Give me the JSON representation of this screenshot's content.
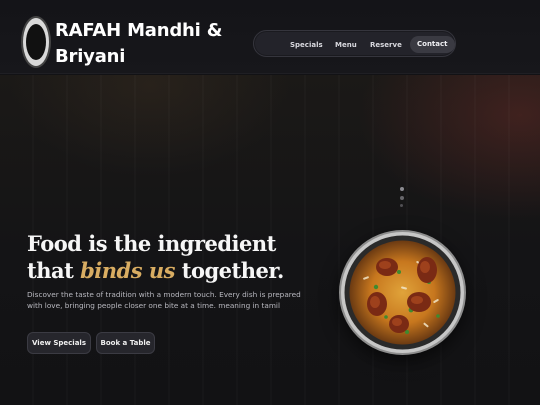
{
  "header": {
    "brand": "RAFAH Mandhi & Briyani",
    "nav": [
      {
        "label": "Specials"
      },
      {
        "label": "Menu"
      },
      {
        "label": "Reserve"
      },
      {
        "label": "Contact"
      }
    ]
  },
  "hero": {
    "headline_line1": "Food is the ingredient",
    "headline_that": "that",
    "headline_accent": "binds us",
    "headline_end": "together.",
    "description": "Discover the taste of tradition with a modern touch. Every dish is prepared with love, bringing people closer one bite at a time. meaning in tamil",
    "buttons": [
      {
        "label": "View Specials"
      },
      {
        "label": "Book a Table"
      }
    ]
  },
  "colors": {
    "accent": "#d9ad62",
    "background": "#121215"
  }
}
